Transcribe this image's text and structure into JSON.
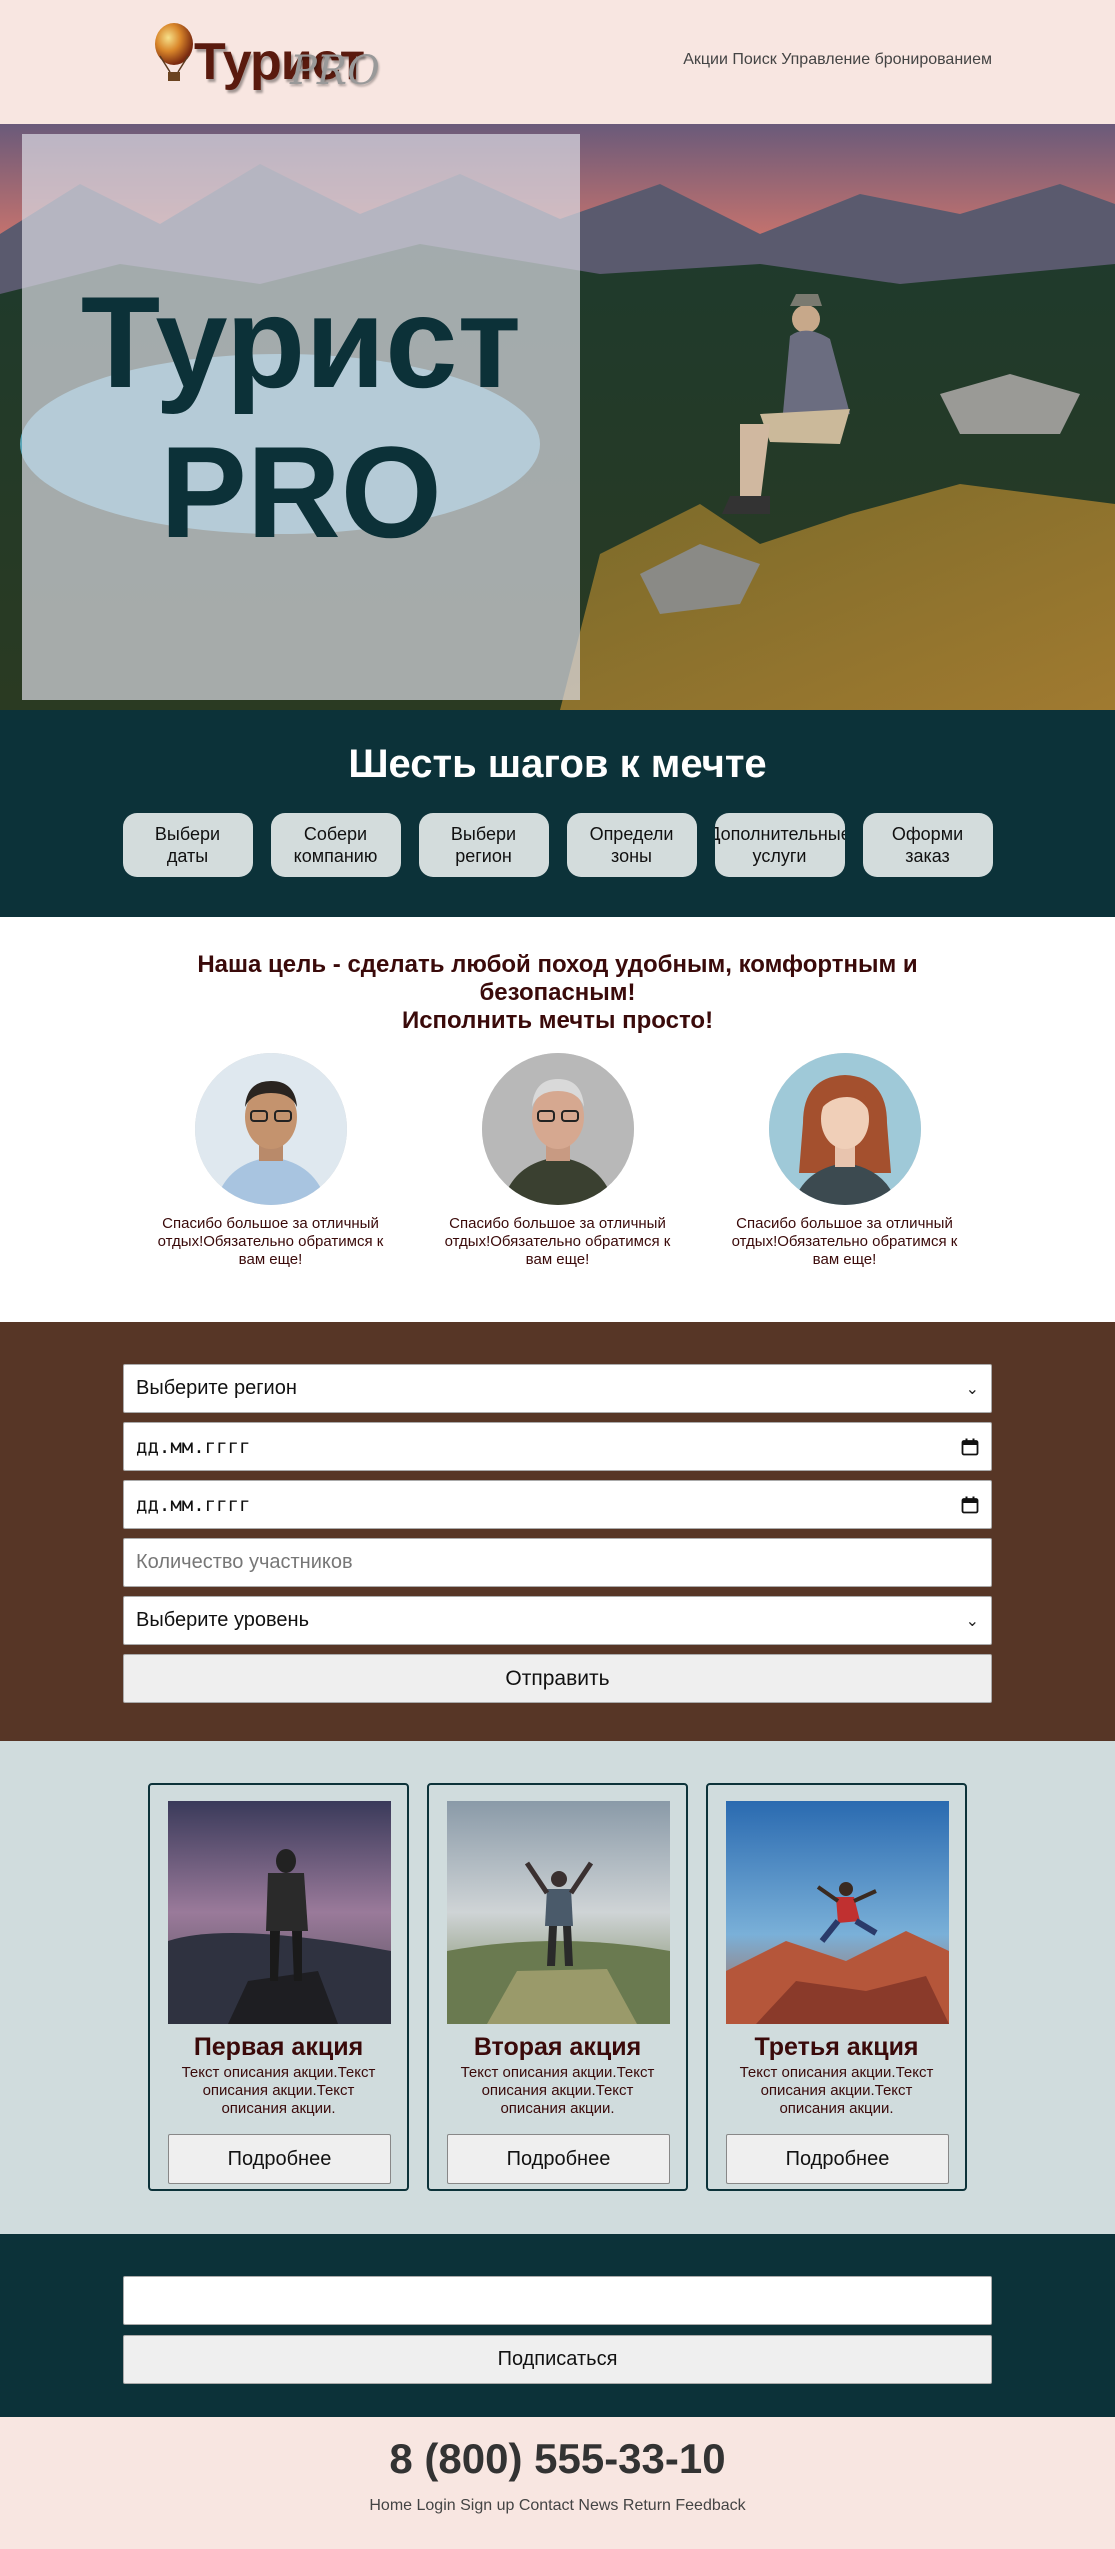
{
  "header": {
    "logo_text": "Турист",
    "logo_pro": "PRO",
    "nav": [
      "Акции",
      "Поиск",
      "Управление бронированием"
    ]
  },
  "hero": {
    "title_line1": "Турист",
    "title_line2": "PRO"
  },
  "steps": {
    "title": "Шесть шагов к мечте",
    "items": [
      {
        "line1": "Выбери",
        "line2": "даты"
      },
      {
        "line1": "Собери",
        "line2": "компанию"
      },
      {
        "line1": "Выбери",
        "line2": "регион"
      },
      {
        "line1": "Определи",
        "line2": "зоны"
      },
      {
        "line1": "Дополнительные",
        "line2": "услуги"
      },
      {
        "line1": "Оформи",
        "line2": "заказ"
      }
    ]
  },
  "testimonials": {
    "goal_line1": "Наша цель - сделать любой поход удобным, комфортным и безопасным!",
    "goal_line2": "Исполнить мечты просто!",
    "quotes": [
      "Спасибо большое за отличный отдых!Обязательно обратимся к вам еще!",
      "Спасибо большое за отличный отдых!Обязательно обратимся к вам еще!",
      "Спасибо большое за отличный отдых!Обязательно обратимся к вам еще!"
    ]
  },
  "booking_form": {
    "region_select": "Выберите регион",
    "date_from": "дд.мм.гггг",
    "date_to": "дд.мм.гггг",
    "participants_placeholder": "Количество участников",
    "level_select": "Выберите уровень",
    "submit_label": "Отправить"
  },
  "promos": [
    {
      "title": "Первая акция",
      "text": "Текст описания акции.Текст описания акции.Текст описания акции.",
      "button": "Подробнее"
    },
    {
      "title": "Вторая акция",
      "text": "Текст описания акции.Текст описания акции.Текст описания акции.",
      "button": "Подробнее"
    },
    {
      "title": "Третья акция",
      "text": "Текст описания акции.Текст описания акции.Текст описания акции.",
      "button": "Подробнее"
    }
  ],
  "subscribe": {
    "email_value": "",
    "button_label": "Подписаться"
  },
  "footer": {
    "phone": "8 (800) 555-33-10",
    "links": [
      "Home",
      "Login",
      "Sign up",
      "Contact",
      "News",
      "Return",
      "Feedback"
    ]
  },
  "colors": {
    "header_bg": "#f8e6e1",
    "dark_teal": "#0c3239",
    "brown": "#573626",
    "light_teal": "#d0dcdd",
    "step_bg": "#d3dcdc",
    "text_dark_red": "#3a0a0a"
  }
}
